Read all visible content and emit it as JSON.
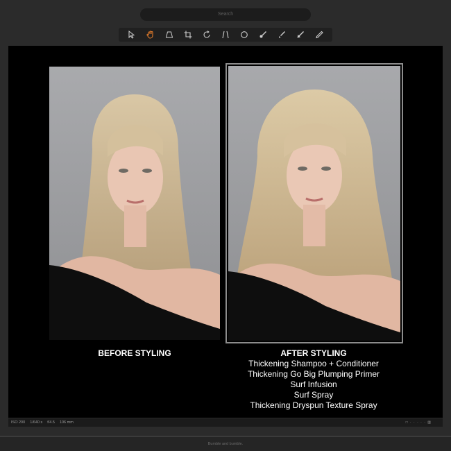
{
  "search": {
    "placeholder": "Search"
  },
  "toolbar": {
    "tools": [
      {
        "icon": "select-arrow-icon",
        "active": false
      },
      {
        "icon": "hand-pan-icon",
        "active": true
      },
      {
        "icon": "keystone-icon",
        "active": false
      },
      {
        "icon": "crop-icon",
        "active": false
      },
      {
        "icon": "rotate-icon",
        "active": false
      },
      {
        "icon": "line-tool-icon",
        "active": false
      },
      {
        "icon": "circle-tool-icon",
        "active": false
      },
      {
        "icon": "brush-icon",
        "active": false
      },
      {
        "icon": "eraser-brush-icon",
        "active": false
      },
      {
        "icon": "arrow-annotate-icon",
        "active": false
      },
      {
        "icon": "pencil-icon",
        "active": false
      }
    ],
    "active_color": "#e07a2a"
  },
  "before": {
    "caption": "BEFORE STYLING"
  },
  "after": {
    "caption": "AFTER STYLING",
    "products": [
      "Thickening Shampoo + Conditioner",
      "Thickening Go Big Plumping Primer",
      "Surf Infusion",
      "Surf Spray",
      "Thickening Dryspun Texture Spray"
    ]
  },
  "status": {
    "iso": "ISO 200",
    "shutter": "1/640 s",
    "aperture": "f/4.5",
    "focal": "106 mm",
    "view_controls": "□ · · · · · ▥"
  },
  "footer": {
    "text": "Bumble and bumble."
  }
}
